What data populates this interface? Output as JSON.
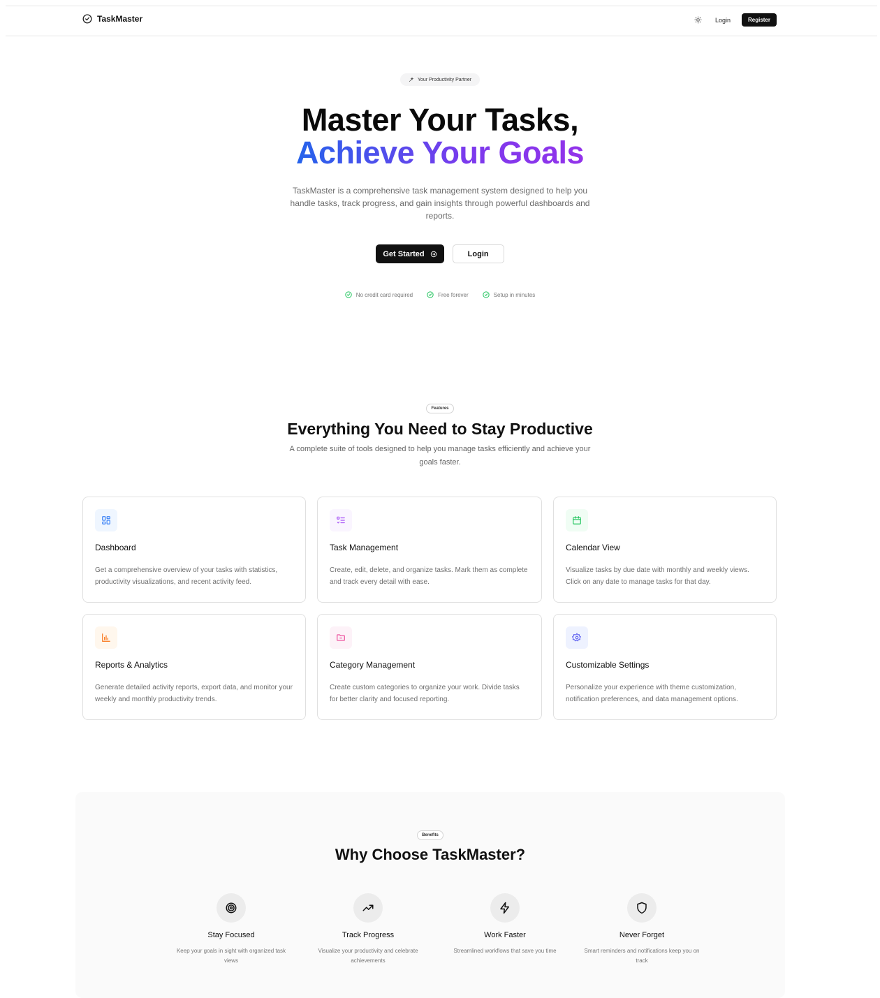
{
  "nav": {
    "brand": "TaskMaster",
    "login": "Login",
    "register": "Register"
  },
  "hero": {
    "badge": "Your Productivity Partner",
    "title_line1": "Master Your Tasks,",
    "title_line2": "Achieve Your Goals",
    "description": "TaskMaster is a comprehensive task management system designed to help you handle tasks, track progress, and gain insights through powerful dashboards and reports.",
    "primary_cta": "Get Started",
    "secondary_cta": "Login",
    "checks": [
      "No credit card required",
      "Free forever",
      "Setup in minutes"
    ]
  },
  "features": {
    "tag": "Features",
    "title": "Everything You Need to Stay Productive",
    "subtitle": "A complete suite of tools designed to help you manage tasks efficiently and achieve your goals faster.",
    "items": [
      {
        "title": "Dashboard",
        "description": "Get a comprehensive overview of your tasks with statistics, productivity visualizations, and recent activity feed.",
        "icon": "dashboard-icon",
        "color": "#3b82f6",
        "bg": "#eff6ff"
      },
      {
        "title": "Task Management",
        "description": "Create, edit, delete, and organize tasks. Mark them as complete and track every detail with ease.",
        "icon": "list-checks-icon",
        "color": "#a855f7",
        "bg": "#faf5ff"
      },
      {
        "title": "Calendar View",
        "description": "Visualize tasks by due date with monthly and weekly views. Click on any date to manage tasks for that day.",
        "icon": "calendar-icon",
        "color": "#22c55e",
        "bg": "#f0fdf4"
      },
      {
        "title": "Reports & Analytics",
        "description": "Generate detailed activity reports, export data, and monitor your weekly and monthly productivity trends.",
        "icon": "bar-chart-icon",
        "color": "#f97316",
        "bg": "#fff7ed"
      },
      {
        "title": "Category Management",
        "description": "Create custom categories to organize your work. Divide tasks for better clarity and focused reporting.",
        "icon": "folder-icon",
        "color": "#ec4899",
        "bg": "#fdf2f8"
      },
      {
        "title": "Customizable Settings",
        "description": "Personalize your experience with theme customization, notification preferences, and data management options.",
        "icon": "gear-icon",
        "color": "#6366f1",
        "bg": "#eef2ff"
      }
    ]
  },
  "benefits": {
    "tag": "Benefits",
    "title": "Why Choose TaskMaster?",
    "items": [
      {
        "title": "Stay Focused",
        "description": "Keep your goals in sight with organized task views",
        "icon": "target-icon"
      },
      {
        "title": "Track Progress",
        "description": "Visualize your productivity and celebrate achievements",
        "icon": "trending-up-icon"
      },
      {
        "title": "Work Faster",
        "description": "Streamlined workflows that save you time",
        "icon": "lightning-icon"
      },
      {
        "title": "Never Forget",
        "description": "Smart reminders and notifications keep you on track",
        "icon": "shield-icon"
      }
    ]
  }
}
